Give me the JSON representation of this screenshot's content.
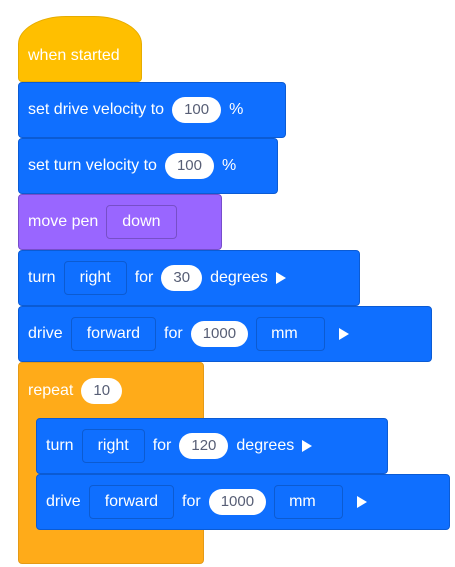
{
  "when_started": {
    "label": "when started"
  },
  "set_drive_velocity": {
    "label": "set drive velocity to",
    "value": "100",
    "unit": "%"
  },
  "set_turn_velocity": {
    "label": "set turn velocity to",
    "value": "100",
    "unit": "%"
  },
  "move_pen": {
    "label": "move pen",
    "option": "down"
  },
  "turn_1": {
    "label": "turn",
    "direction": "right",
    "for_label": "for",
    "value": "30",
    "unit": "degrees"
  },
  "drive_1": {
    "label": "drive",
    "direction": "forward",
    "for_label": "for",
    "value": "1000",
    "unit": "mm"
  },
  "repeat": {
    "label": "repeat",
    "count": "10"
  },
  "turn_2": {
    "label": "turn",
    "direction": "right",
    "for_label": "for",
    "value": "120",
    "unit": "degrees"
  },
  "drive_2": {
    "label": "drive",
    "direction": "forward",
    "for_label": "for",
    "value": "1000",
    "unit": "mm"
  },
  "colors": {
    "events": "#FFBF00",
    "motion": "#0F6FFF",
    "looks": "#9966FF",
    "control": "#FFAB19"
  }
}
